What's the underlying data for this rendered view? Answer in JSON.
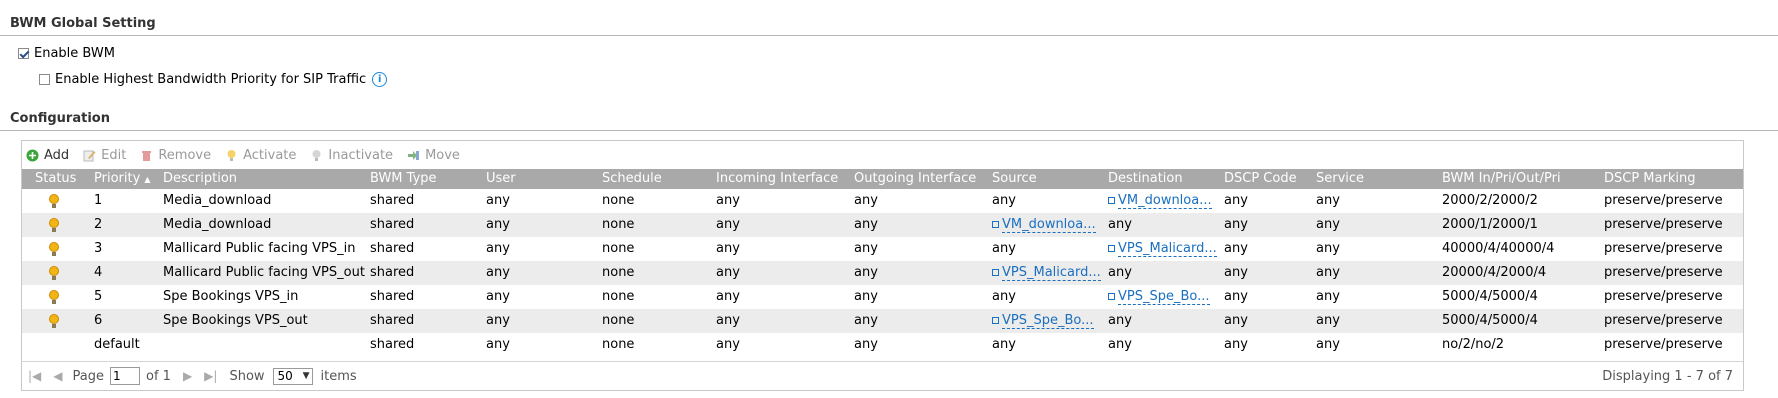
{
  "global": {
    "title": "BWM Global Setting",
    "enable_bwm_label": "Enable BWM",
    "enable_bwm_checked": true,
    "sip_label": "Enable Highest Bandwidth Priority for SIP Traffic",
    "sip_checked": false
  },
  "config": {
    "title": "Configuration"
  },
  "toolbar": {
    "add": "Add",
    "edit": "Edit",
    "remove": "Remove",
    "activate": "Activate",
    "inactivate": "Inactivate",
    "move": "Move"
  },
  "columns": [
    "Status",
    "Priority",
    "Description",
    "BWM Type",
    "User",
    "Schedule",
    "Incoming Interface",
    "Outgoing Interface",
    "Source",
    "Destination",
    "DSCP Code",
    "Service",
    "BWM In/Pri/Out/Pri",
    "DSCP Marking"
  ],
  "sort_indicator": "▲",
  "rows": [
    {
      "status": "on",
      "priority": "1",
      "description": "Media_download",
      "bwm_type": "shared",
      "user": "any",
      "schedule": "none",
      "incoming": "any",
      "outgoing": "any",
      "source": "any",
      "destination": "VM_downloa...",
      "dscp": "any",
      "service": "any",
      "bwm": "2000/2/2000/2",
      "marking": "preserve/preserve"
    },
    {
      "status": "on",
      "priority": "2",
      "description": "Media_download",
      "bwm_type": "shared",
      "user": "any",
      "schedule": "none",
      "incoming": "any",
      "outgoing": "any",
      "source": "VM_downloa...",
      "destination": "any",
      "dscp": "any",
      "service": "any",
      "bwm": "2000/1/2000/1",
      "marking": "preserve/preserve"
    },
    {
      "status": "on",
      "priority": "3",
      "description": "Mallicard Public facing VPS_in",
      "bwm_type": "shared",
      "user": "any",
      "schedule": "none",
      "incoming": "any",
      "outgoing": "any",
      "source": "any",
      "destination": "VPS_Malicard...",
      "dscp": "any",
      "service": "any",
      "bwm": "40000/4/40000/4",
      "marking": "preserve/preserve"
    },
    {
      "status": "on",
      "priority": "4",
      "description": "Mallicard Public facing VPS_out",
      "bwm_type": "shared",
      "user": "any",
      "schedule": "none",
      "incoming": "any",
      "outgoing": "any",
      "source": "VPS_Malicard...",
      "destination": "any",
      "dscp": "any",
      "service": "any",
      "bwm": "20000/4/2000/4",
      "marking": "preserve/preserve"
    },
    {
      "status": "on",
      "priority": "5",
      "description": "Spe Bookings VPS_in",
      "bwm_type": "shared",
      "user": "any",
      "schedule": "none",
      "incoming": "any",
      "outgoing": "any",
      "source": "any",
      "destination": "VPS_Spe_Bo...",
      "dscp": "any",
      "service": "any",
      "bwm": "5000/4/5000/4",
      "marking": "preserve/preserve"
    },
    {
      "status": "on",
      "priority": "6",
      "description": "Spe Bookings VPS_out",
      "bwm_type": "shared",
      "user": "any",
      "schedule": "none",
      "incoming": "any",
      "outgoing": "any",
      "source": "VPS_Spe_Bo...",
      "destination": "any",
      "dscp": "any",
      "service": "any",
      "bwm": "5000/4/5000/4",
      "marking": "preserve/preserve"
    },
    {
      "status": "",
      "priority": "default",
      "description": "",
      "bwm_type": "shared",
      "user": "any",
      "schedule": "none",
      "incoming": "any",
      "outgoing": "any",
      "source": "any",
      "destination": "any",
      "dscp": "any",
      "service": "any",
      "bwm": "no/2/no/2",
      "marking": "preserve/preserve"
    }
  ],
  "pager": {
    "page_label": "Page",
    "page_value": "1",
    "of_label": "of 1",
    "show_label": "Show",
    "show_value": "50",
    "items_label": "items",
    "displaying": "Displaying 1 - 7 of 7"
  }
}
